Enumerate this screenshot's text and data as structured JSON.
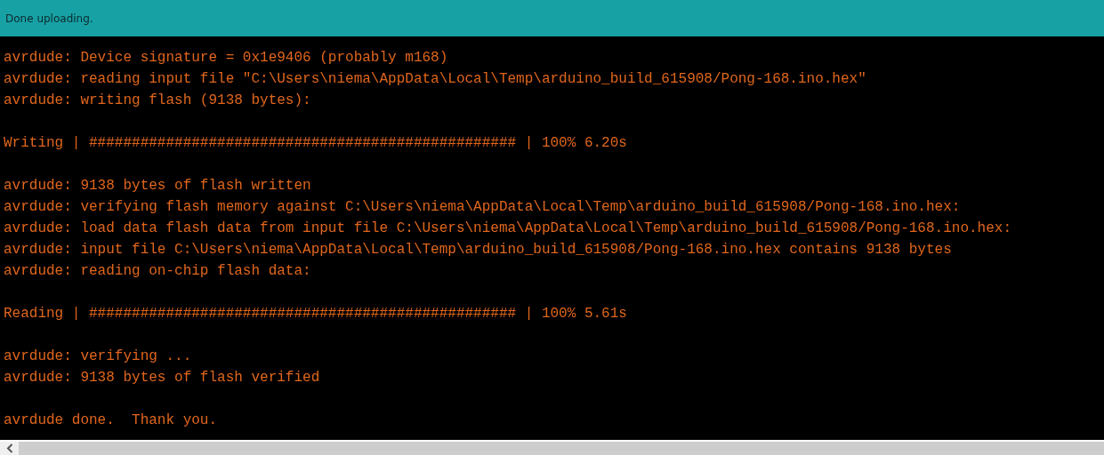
{
  "status_bar": {
    "message": "Done uploading."
  },
  "console": {
    "blocks": [
      [
        "avrdude: Device signature = 0x1e9406 (probably m168)",
        "avrdude: reading input file \"C:\\Users\\niema\\AppData\\Local\\Temp\\arduino_build_615908/Pong-168.ino.hex\"",
        "avrdude: writing flash (9138 bytes):"
      ],
      [
        "Writing | ################################################## | 100% 6.20s"
      ],
      [
        "avrdude: 9138 bytes of flash written",
        "avrdude: verifying flash memory against C:\\Users\\niema\\AppData\\Local\\Temp\\arduino_build_615908/Pong-168.ino.hex:",
        "avrdude: load data flash data from input file C:\\Users\\niema\\AppData\\Local\\Temp\\arduino_build_615908/Pong-168.ino.hex:",
        "avrdude: input file C:\\Users\\niema\\AppData\\Local\\Temp\\arduino_build_615908/Pong-168.ino.hex contains 9138 bytes",
        "avrdude: reading on-chip flash data:"
      ],
      [
        "Reading | ################################################## | 100% 5.61s"
      ],
      [
        "avrdude: verifying ...",
        "avrdude: 9138 bytes of flash verified"
      ],
      [
        "avrdude done.  Thank you."
      ]
    ]
  }
}
